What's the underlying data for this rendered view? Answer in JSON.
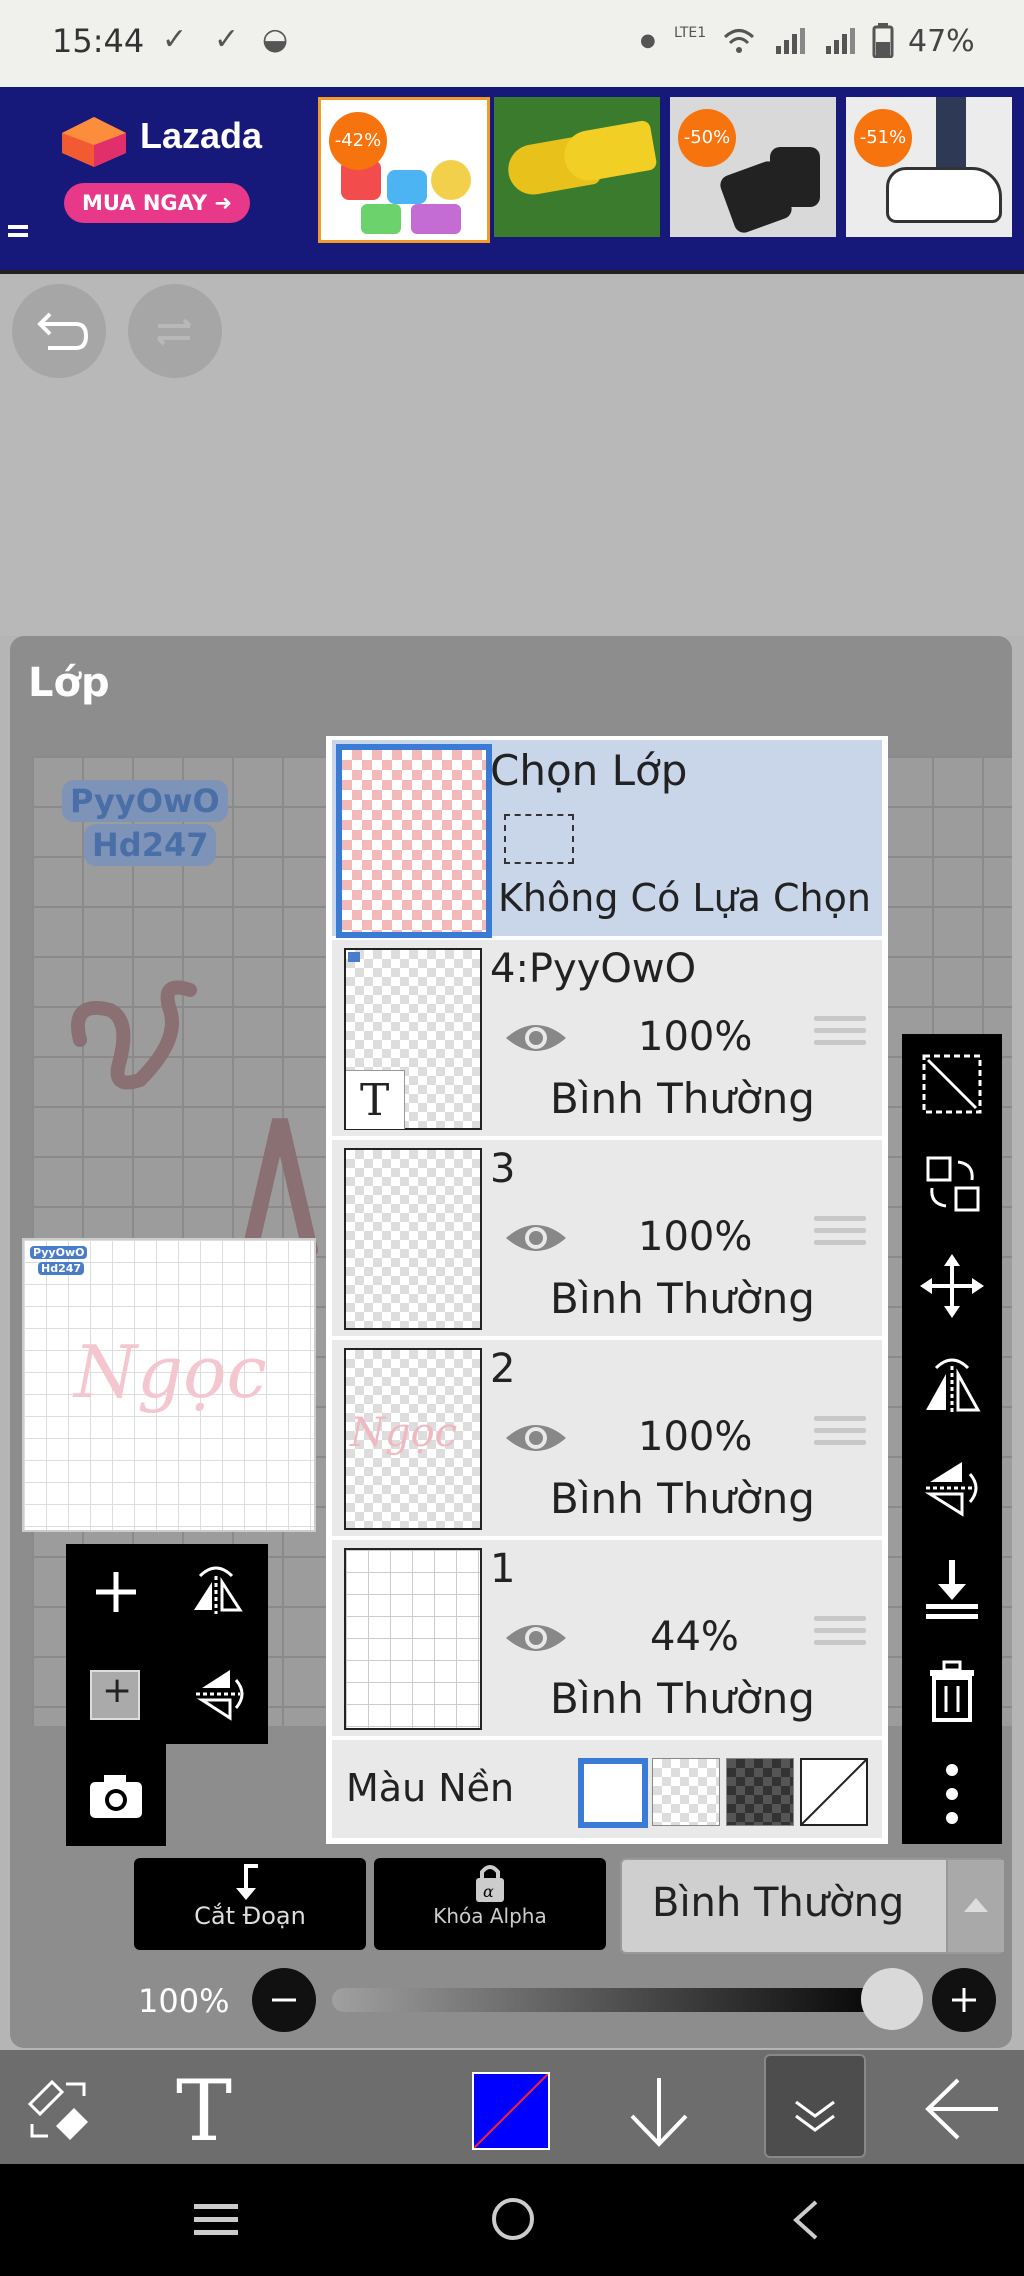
{
  "status": {
    "time": "15:44",
    "battery": "47%",
    "network_label": "LTE1"
  },
  "ad": {
    "brand": "Lazada",
    "cta": "MUA NGAY",
    "badges": [
      "-42%",
      "-50%",
      "-51%"
    ]
  },
  "panel": {
    "title": "Lớp",
    "canvas_text": [
      "PyyOwO",
      "Hd247"
    ],
    "preview_text": "Ngọc",
    "select_row": {
      "title": "Chọn Lớp",
      "subtitle": "Không Có Lựa Chọn"
    },
    "layers": [
      {
        "name": "4:PyyOwO",
        "opacity": "100%",
        "blend": "Bình Thường",
        "type_glyph": "T"
      },
      {
        "name": "3",
        "opacity": "100%",
        "blend": "Bình Thường"
      },
      {
        "name": "2",
        "opacity": "100%",
        "blend": "Bình Thường"
      },
      {
        "name": "1",
        "opacity": "44%",
        "blend": "Bình Thường"
      }
    ],
    "background_label": "Màu Nền",
    "clip_label": "Cắt Đoạn",
    "alpha_lock_label": "Khóa Alpha",
    "blend_mode": "Bình Thường",
    "opacity_label": "100%",
    "opacity_value": 1.0
  },
  "colors": {
    "primary_color": "#0000ff",
    "accent": "#3a7bd5",
    "select_row_bg": "#c9d6ea"
  },
  "icons": [
    "undo-icon",
    "redo-icon",
    "add-layer-icon",
    "flip-horizontal-icon",
    "flip-vertical-icon",
    "camera-icon",
    "select-icon",
    "transform-icon",
    "move-icon",
    "merge-down-icon",
    "trash-icon",
    "more-icon",
    "eye-icon",
    "text-tool-icon",
    "arrow-down-icon",
    "back-arrow-icon"
  ]
}
